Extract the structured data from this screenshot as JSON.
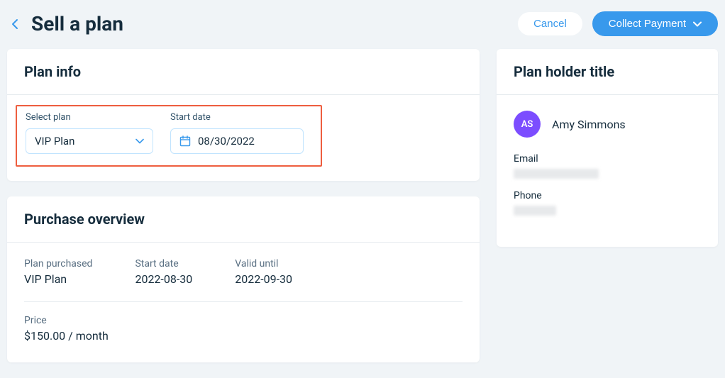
{
  "header": {
    "title": "Sell a plan",
    "cancel_label": "Cancel",
    "collect_label": "Collect Payment"
  },
  "plan_info": {
    "card_title": "Plan info",
    "select_label": "Select plan",
    "select_value": "VIP Plan",
    "date_label": "Start date",
    "date_value": "08/30/2022"
  },
  "overview": {
    "card_title": "Purchase overview",
    "plan_purchased_label": "Plan purchased",
    "plan_purchased_value": "VIP Plan",
    "start_date_label": "Start date",
    "start_date_value": "2022-08-30",
    "valid_until_label": "Valid until",
    "valid_until_value": "2022-09-30",
    "price_label": "Price",
    "price_value": "$150.00 / month"
  },
  "holder": {
    "card_title": "Plan holder title",
    "initials": "AS",
    "name": "Amy Simmons",
    "email_label": "Email",
    "phone_label": "Phone"
  }
}
